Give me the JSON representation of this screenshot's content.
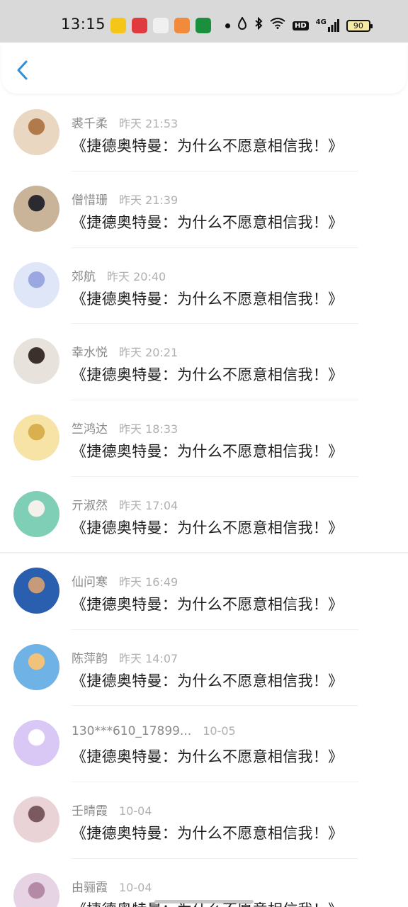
{
  "status_bar": {
    "time": "13:15",
    "network": "4G",
    "hd": "HD",
    "battery": "90",
    "app_icons": [
      {
        "name": "tomato-novel-icon",
        "color": "#f5c518"
      },
      {
        "name": "toutiao-icon",
        "color": "#e03a3e"
      },
      {
        "name": "gallery-icon",
        "color": "#f0f0f0"
      },
      {
        "name": "book-icon",
        "color": "#f28a3c"
      },
      {
        "name": "oppo-icon",
        "color": "#1a8f3d"
      }
    ]
  },
  "header": {
    "back_icon": "chevron-left-icon",
    "accent": "#2f8fd8"
  },
  "messages": [
    {
      "name": "裘千柔",
      "time": "昨天 21:53",
      "text": "《捷德奥特曼：为什么不愿意相信我！》",
      "avatar_colors": [
        "#e9d7c2",
        "#b07a4a"
      ]
    },
    {
      "name": "僧惜珊",
      "time": "昨天 21:39",
      "text": "《捷德奥特曼：为什么不愿意相信我！》",
      "avatar_colors": [
        "#c9b49a",
        "#2a2a30"
      ]
    },
    {
      "name": "郊航",
      "time": "昨天 20:40",
      "text": "《捷德奥特曼：为什么不愿意相信我！》",
      "avatar_colors": [
        "#dfe6f7",
        "#9aa7e0"
      ]
    },
    {
      "name": "幸水悦",
      "time": "昨天 20:21",
      "text": "《捷德奥特曼：为什么不愿意相信我！》",
      "avatar_colors": [
        "#e8e2dc",
        "#3b302c"
      ]
    },
    {
      "name": "竺鸿达",
      "time": "昨天 18:33",
      "text": "《捷德奥特曼：为什么不愿意相信我！》",
      "avatar_colors": [
        "#f7e3a6",
        "#d8b04f"
      ]
    },
    {
      "name": "亓淑然",
      "time": "昨天 17:04",
      "text": "《捷德奥特曼：为什么不愿意相信我！》",
      "avatar_colors": [
        "#7fcfb6",
        "#f4f1ec"
      ]
    },
    {
      "name": "仙问寒",
      "time": "昨天 16:49",
      "text": "《捷德奥特曼：为什么不愿意相信我！》",
      "avatar_colors": [
        "#2a5fb0",
        "#c79b7a"
      ]
    },
    {
      "name": "陈萍韵",
      "time": "昨天 14:07",
      "text": "《捷德奥特曼：为什么不愿意相信我！》",
      "avatar_colors": [
        "#6fb2e6",
        "#f0c27a"
      ]
    },
    {
      "name": "130***610_17899...",
      "time": "10-05",
      "text": "《捷德奥特曼：为什么不愿意相信我！》",
      "avatar_colors": [
        "#d9c8f5",
        "#ffffff"
      ]
    },
    {
      "name": "壬晴霞",
      "time": "10-04",
      "text": "《捷德奥特曼：为什么不愿意相信我！》",
      "avatar_colors": [
        "#e9d3d6",
        "#7a5a5e"
      ]
    },
    {
      "name": "由骊霞",
      "time": "10-04",
      "text": "《捷德奥特曼：为什么不愿意相信我！》",
      "avatar_colors": [
        "#e6d3e3",
        "#b58aa6"
      ]
    }
  ]
}
